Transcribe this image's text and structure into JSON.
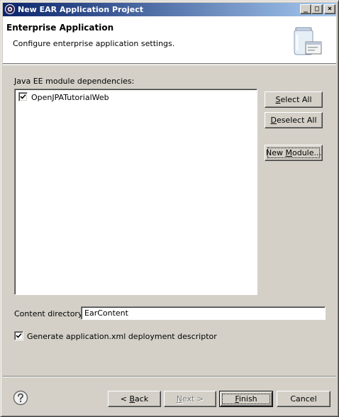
{
  "window": {
    "title": "New EAR Application Project",
    "minimize_glyph": "_",
    "maximize_glyph": "□",
    "close_glyph": "×"
  },
  "banner": {
    "title": "Enterprise Application",
    "description": "Configure enterprise application settings.",
    "icon": "jar-wizard-icon"
  },
  "dependencies": {
    "label": "Java EE module dependencies:",
    "items": [
      {
        "label": "OpenJPATutorialWeb",
        "checked": true
      }
    ]
  },
  "side_buttons": {
    "select_all": {
      "mnemonic": "S",
      "rest": "elect All"
    },
    "deselect_all": {
      "mnemonic": "D",
      "rest": "eselect All"
    },
    "new_module": {
      "pre": "New ",
      "mnemonic": "M",
      "rest": "odule..."
    }
  },
  "content_directory": {
    "label": "Content directory:",
    "value": "EarContent"
  },
  "generate_descriptor": {
    "label": "Generate application.xml deployment descriptor",
    "checked": true
  },
  "footer": {
    "help_icon": "help-question-icon",
    "back": {
      "pre": "< ",
      "mnemonic": "B",
      "rest": "ack"
    },
    "next": {
      "mnemonic": "N",
      "rest": "ext >",
      "enabled": false
    },
    "finish": {
      "mnemonic": "F",
      "rest": "inish"
    },
    "cancel": "Cancel"
  }
}
